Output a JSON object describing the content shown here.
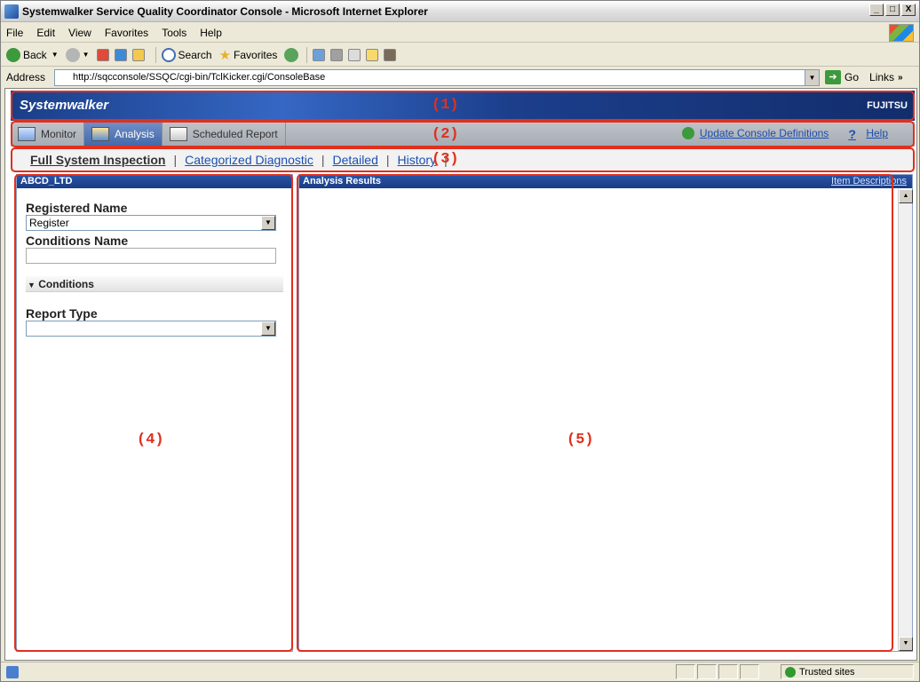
{
  "window": {
    "title": "Systemwalker Service Quality Coordinator Console - Microsoft Internet Explorer",
    "buttons": [
      "_",
      "□",
      "X"
    ]
  },
  "menu": [
    "File",
    "Edit",
    "View",
    "Favorites",
    "Tools",
    "Help"
  ],
  "toolbar": {
    "back": "Back",
    "search": "Search",
    "favorites": "Favorites"
  },
  "address": {
    "label": "Address",
    "url": "http://sqcconsole/SSQC/cgi-bin/TclKicker.cgi/ConsoleBase",
    "go": "Go",
    "links": "Links"
  },
  "brand": {
    "logo": "Systemwalker",
    "vendor": "FUJITSU"
  },
  "tabs": [
    {
      "label": "Monitor",
      "active": false
    },
    {
      "label": "Analysis",
      "active": true
    },
    {
      "label": "Scheduled Report",
      "active": false
    }
  ],
  "tab_links": {
    "update": "Update Console Definitions",
    "help": "Help"
  },
  "subnav": [
    {
      "label": "Full System Inspection",
      "current": true
    },
    {
      "label": "Categorized Diagnostic",
      "current": false
    },
    {
      "label": "Detailed",
      "current": false
    },
    {
      "label": "History",
      "current": false
    }
  ],
  "left_panel": {
    "header": "ABCD_LTD",
    "registered_name_label": "Registered Name",
    "registered_name_value": "Register",
    "conditions_name_label": "Conditions Name",
    "conditions_section": "Conditions",
    "report_type_label": "Report Type"
  },
  "right_panel": {
    "header": "Analysis Results",
    "item_descriptions": "Item Descriptions"
  },
  "annotations": [
    "(1)",
    "(2)",
    "(3)",
    "(4)",
    "(5)"
  ],
  "status": {
    "zone": "Trusted sites"
  }
}
